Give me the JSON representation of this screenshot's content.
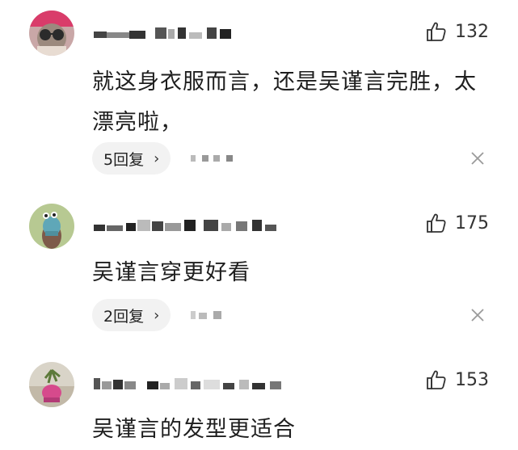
{
  "comments": [
    {
      "username": "",
      "likes": "132",
      "text": "就这身衣服而言，还是吴谨言完胜，太漂亮啦，",
      "reply_label": "5回复",
      "reply_icon": "chevron-right"
    },
    {
      "username": "",
      "likes": "175",
      "text": "吴谨言穿更好看",
      "reply_label": "2回复",
      "reply_icon": "chevron-right"
    },
    {
      "username": "",
      "likes": "153",
      "text": "吴谨言的发型更适合"
    }
  ],
  "icons": {
    "like": "thumbs-up-icon",
    "close": "close-icon"
  },
  "colors": {
    "pill_bg": "#f2f2f2",
    "text": "#1e1e1e",
    "muted": "#333333"
  }
}
